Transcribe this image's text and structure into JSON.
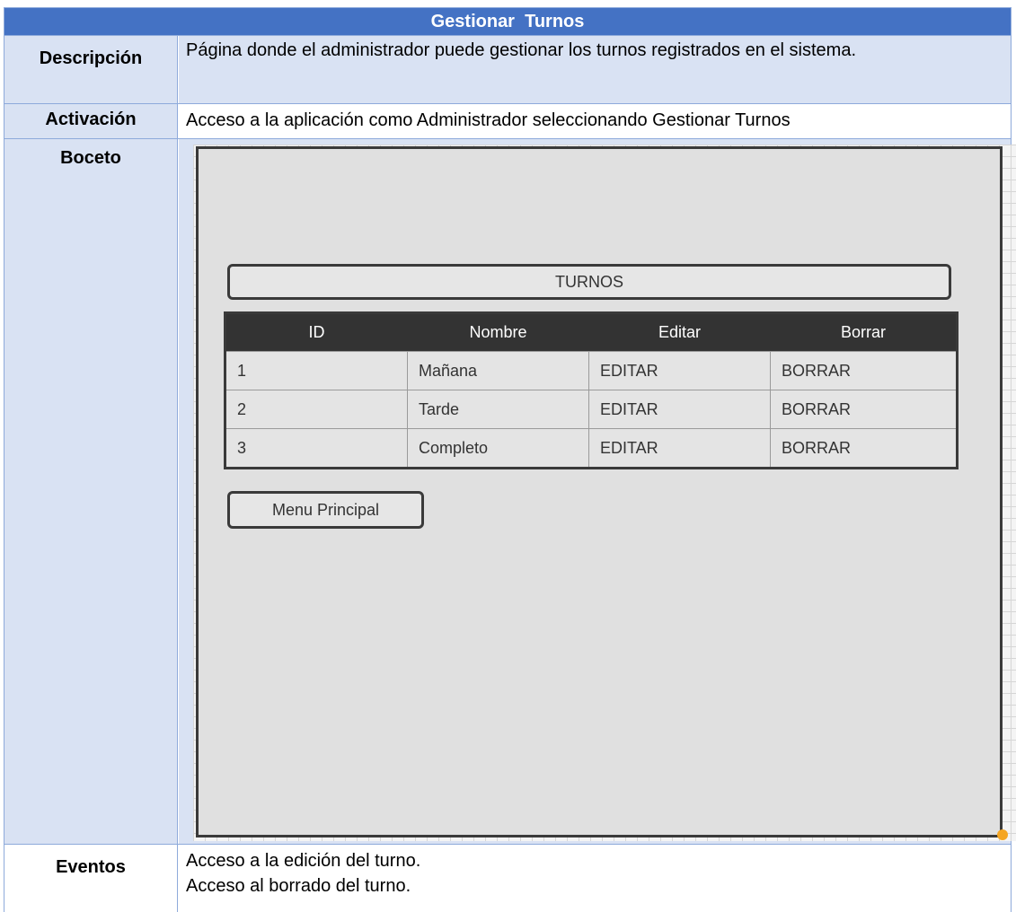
{
  "title": "Gestionar  Turnos",
  "rows": {
    "descripcion": {
      "label": "Descripción",
      "text": "Página donde el administrador puede gestionar los turnos registrados en el sistema."
    },
    "activacion": {
      "label": "Activación",
      "text": "Acceso a la aplicación como Administrador seleccionando Gestionar Turnos"
    },
    "boceto": {
      "label": "Boceto"
    },
    "eventos": {
      "label": "Eventos",
      "lines": [
        "Acceso a la edición del turno.",
        "Acceso al borrado del turno."
      ]
    }
  },
  "mockup": {
    "panel_title": "TURNOS",
    "table": {
      "headers": [
        "ID",
        "Nombre",
        "Editar",
        "Borrar"
      ],
      "rows": [
        [
          "1",
          "Mañana",
          "EDITAR",
          "BORRAR"
        ],
        [
          "2",
          "Tarde",
          "EDITAR",
          "BORRAR"
        ],
        [
          "3",
          "Completo",
          "EDITAR",
          "BORRAR"
        ]
      ]
    },
    "menu_button": "Menu Principal"
  },
  "colors": {
    "header_bg": "#4472c4",
    "label_bg": "#d9e2f3",
    "table_header_bg": "#333333",
    "resize_handle": "#f5a623"
  }
}
